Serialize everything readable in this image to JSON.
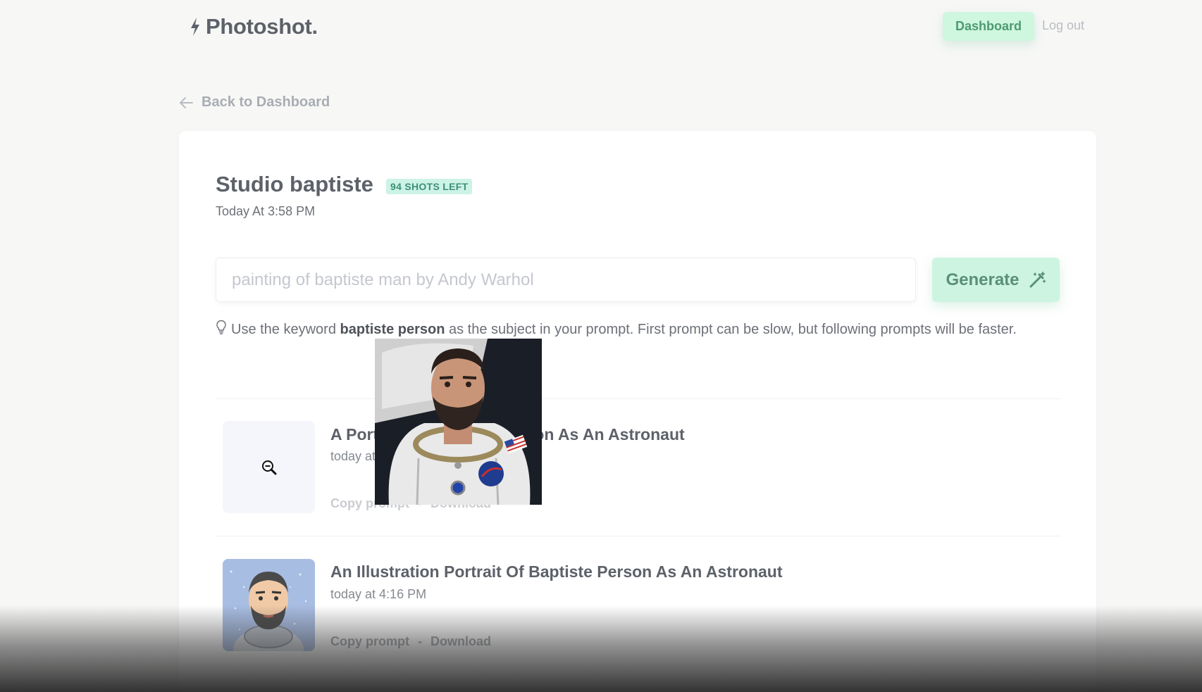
{
  "header": {
    "logo_text": "Photoshot.",
    "nav": {
      "dashboard_label": "Dashboard",
      "logout_label": "Log out"
    }
  },
  "back_link": {
    "label": "Back to Dashboard"
  },
  "studio": {
    "title": "Studio baptiste",
    "badge": "94 SHOTS LEFT",
    "date": "Today At 3:58 PM"
  },
  "prompt": {
    "placeholder": "painting of baptiste man by Andy Warhol",
    "generate_label": "Generate"
  },
  "hint": {
    "pre": "Use the keyword ",
    "keyword": "baptiste person",
    "post": " as the subject in your prompt. First prompt can be slow, but following prompts will be faster."
  },
  "shots": [
    {
      "title": "A Portrait Of Baptiste Person As An Astronaut",
      "time": "today at 4:16 PM",
      "copy_label": "Copy prompt",
      "separator": "-",
      "download_label": "Download"
    },
    {
      "title": "An Illustration Portrait Of Baptiste Person As An Astronaut",
      "time": "today at 4:16 PM",
      "copy_label": "Copy prompt",
      "separator": "-",
      "download_label": "Download"
    }
  ],
  "colors": {
    "accent_bg": "#cff6df",
    "accent_text": "#4e9a72",
    "badge_bg": "#ccf3e6"
  }
}
